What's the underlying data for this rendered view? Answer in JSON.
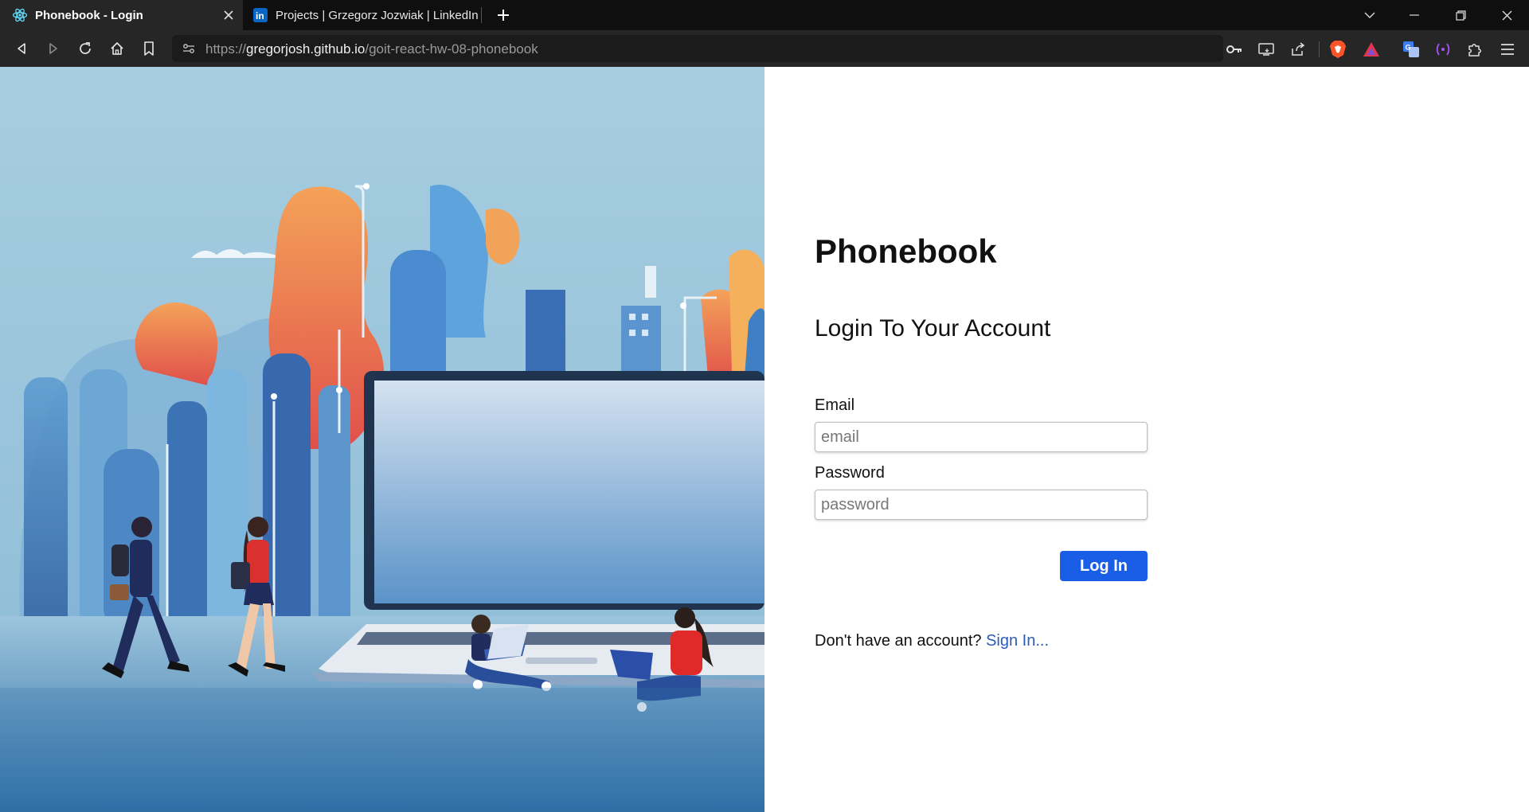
{
  "browser": {
    "tabs": [
      {
        "title": "Phonebook - Login",
        "favicon": "react-icon",
        "active": true
      },
      {
        "title": "Projects | Grzegorz Jozwiak | LinkedIn",
        "favicon": "linkedin-icon",
        "active": false
      }
    ],
    "url": {
      "scheme": "https://",
      "host": "gregorjosh.github.io",
      "path": "/goit-react-hw-08-phonebook"
    },
    "colors": {
      "tabbar": "#0f0f10",
      "toolbar": "#262626",
      "brave": "#fb542b"
    }
  },
  "page": {
    "brand": "Phonebook",
    "subtitle": "Login To Your Account",
    "email": {
      "label": "Email",
      "placeholder": "email",
      "value": ""
    },
    "password": {
      "label": "Password",
      "placeholder": "password",
      "value": ""
    },
    "submit_label": "Log In",
    "signup_prompt": "Don't have an account?",
    "signup_link": "Sign In...",
    "colors": {
      "button": "#1a5ee8",
      "link": "#2a5cbc"
    }
  }
}
